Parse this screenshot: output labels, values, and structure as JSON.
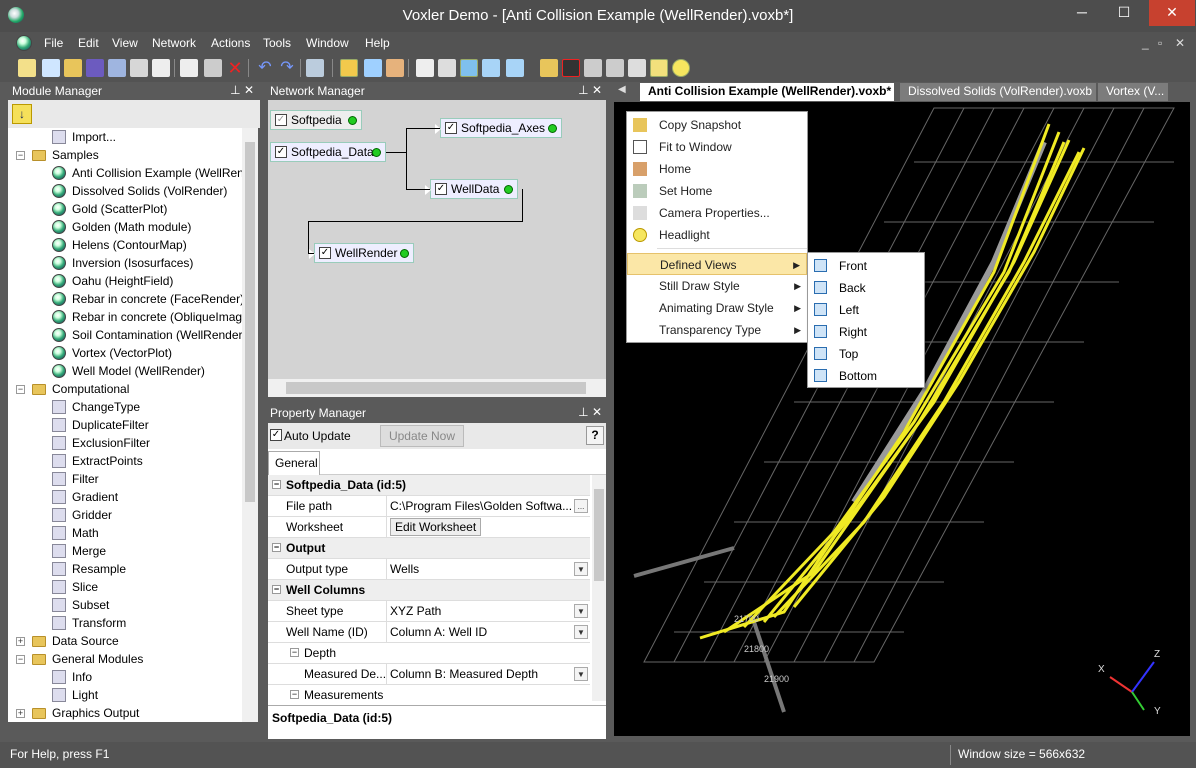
{
  "window": {
    "title": "Voxler Demo - [Anti Collision Example (WellRender).voxb*]",
    "min": "─",
    "max": "☐",
    "close": "✕"
  },
  "menu": [
    "File",
    "Edit",
    "View",
    "Network",
    "Actions",
    "Tools",
    "Window",
    "Help"
  ],
  "mdi_controls": [
    "_",
    "▫",
    "✕"
  ],
  "module_manager": {
    "title": "Module Manager",
    "tree": [
      {
        "label": "Import...",
        "level": 1,
        "icon": "import"
      },
      {
        "label": "Samples",
        "level": 0,
        "icon": "folder",
        "expanded": true
      },
      {
        "label": "Anti Collision Example (WellRen",
        "level": 1,
        "icon": "sphere"
      },
      {
        "label": "Dissolved Solids (VolRender)",
        "level": 1,
        "icon": "sphere"
      },
      {
        "label": "Gold (ScatterPlot)",
        "level": 1,
        "icon": "sphere"
      },
      {
        "label": "Golden (Math module)",
        "level": 1,
        "icon": "sphere"
      },
      {
        "label": "Helens (ContourMap)",
        "level": 1,
        "icon": "sphere"
      },
      {
        "label": "Inversion (Isosurfaces)",
        "level": 1,
        "icon": "sphere"
      },
      {
        "label": "Oahu (HeightField)",
        "level": 1,
        "icon": "sphere"
      },
      {
        "label": "Rebar in concrete (FaceRender)",
        "level": 1,
        "icon": "sphere"
      },
      {
        "label": "Rebar in concrete (ObliqueImag",
        "level": 1,
        "icon": "sphere"
      },
      {
        "label": "Soil Contamination (WellRender",
        "level": 1,
        "icon": "sphere"
      },
      {
        "label": "Vortex (VectorPlot)",
        "level": 1,
        "icon": "sphere"
      },
      {
        "label": "Well Model (WellRender)",
        "level": 1,
        "icon": "sphere"
      },
      {
        "label": "Computational",
        "level": 0,
        "icon": "folder",
        "expanded": true
      },
      {
        "label": "ChangeType",
        "level": 1,
        "icon": "module"
      },
      {
        "label": "DuplicateFilter",
        "level": 1,
        "icon": "module"
      },
      {
        "label": "ExclusionFilter",
        "level": 1,
        "icon": "module"
      },
      {
        "label": "ExtractPoints",
        "level": 1,
        "icon": "module"
      },
      {
        "label": "Filter",
        "level": 1,
        "icon": "module"
      },
      {
        "label": "Gradient",
        "level": 1,
        "icon": "module"
      },
      {
        "label": "Gridder",
        "level": 1,
        "icon": "module"
      },
      {
        "label": "Math",
        "level": 1,
        "icon": "module"
      },
      {
        "label": "Merge",
        "level": 1,
        "icon": "module"
      },
      {
        "label": "Resample",
        "level": 1,
        "icon": "module"
      },
      {
        "label": "Slice",
        "level": 1,
        "icon": "module"
      },
      {
        "label": "Subset",
        "level": 1,
        "icon": "module"
      },
      {
        "label": "Transform",
        "level": 1,
        "icon": "module"
      },
      {
        "label": "Data Source",
        "level": 0,
        "icon": "folder",
        "expanded": false
      },
      {
        "label": "General Modules",
        "level": 0,
        "icon": "folder",
        "expanded": true
      },
      {
        "label": "Info",
        "level": 1,
        "icon": "module"
      },
      {
        "label": "Light",
        "level": 1,
        "icon": "module"
      },
      {
        "label": "Graphics Output",
        "level": 0,
        "icon": "folder",
        "expanded": false
      }
    ]
  },
  "network_manager": {
    "title": "Network Manager",
    "nodes": {
      "n1": "Softpedia",
      "n2": "Softpedia_Data",
      "n3": "Softpedia_Axes",
      "n4": "WellData",
      "n5": "WellRender"
    }
  },
  "property_manager": {
    "title": "Property Manager",
    "auto_update": "Auto Update",
    "update_now": "Update Now",
    "help": "?",
    "tab": "General",
    "rows": [
      {
        "k": "Softpedia_Data (id:5)",
        "v": "",
        "type": "section"
      },
      {
        "k": "File path",
        "v": "C:\\Program Files\\Golden Softwa...",
        "type": "browse"
      },
      {
        "k": "Worksheet",
        "v": "Edit Worksheet",
        "type": "button"
      },
      {
        "k": "Output",
        "v": "",
        "type": "section"
      },
      {
        "k": "Output type",
        "v": "Wells",
        "type": "dropdown"
      },
      {
        "k": "Well Columns",
        "v": "",
        "type": "section"
      },
      {
        "k": "Sheet type",
        "v": "XYZ Path",
        "type": "dropdown"
      },
      {
        "k": "Well Name (ID)",
        "v": "Column A: Well ID",
        "type": "dropdown"
      },
      {
        "k": "Depth",
        "v": "",
        "type": "subsection"
      },
      {
        "k": "Measured De...",
        "v": "Column B: Measured Depth",
        "type": "dropdown"
      },
      {
        "k": "Measurements",
        "v": "",
        "type": "subsection"
      }
    ],
    "footer": "Softpedia_Data (id:5)"
  },
  "tabs": [
    "Anti Collision Example (WellRender).voxb*",
    "Dissolved Solids (VolRender).voxb",
    "Vortex (V..."
  ],
  "context_menu": {
    "items": [
      "Copy Snapshot",
      "Fit to Window",
      "Home",
      "Set Home",
      "Camera Properties...",
      "Headlight",
      "Defined Views",
      "Still Draw Style",
      "Animating Draw Style",
      "Transparency Type"
    ],
    "submenu": [
      "Front",
      "Back",
      "Left",
      "Right",
      "Top",
      "Bottom"
    ]
  },
  "axes": {
    "x": "X",
    "y": "Y",
    "z": "Z"
  },
  "status": {
    "left": "For Help, press F1",
    "right": "Window size = 566x632"
  }
}
